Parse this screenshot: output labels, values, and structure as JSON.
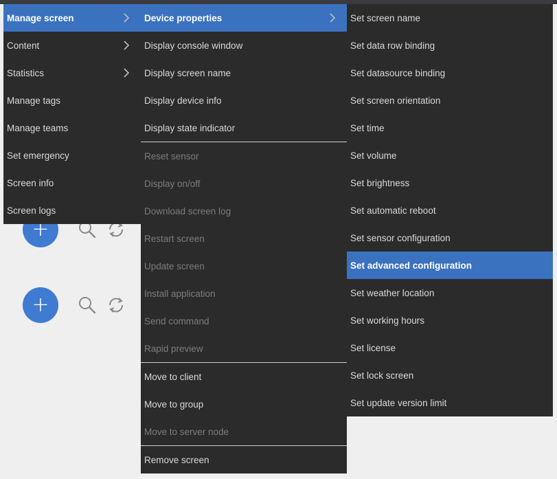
{
  "menu_level1": {
    "items": [
      {
        "label": "Manage screen",
        "active": true,
        "submenu": true,
        "disabled": false
      },
      {
        "label": "Content",
        "active": false,
        "submenu": true,
        "disabled": false
      },
      {
        "label": "Statistics",
        "active": false,
        "submenu": true,
        "disabled": false
      },
      {
        "label": "Manage tags",
        "active": false,
        "submenu": false,
        "disabled": false
      },
      {
        "label": "Manage teams",
        "active": false,
        "submenu": false,
        "disabled": false
      },
      {
        "label": "Set emergency",
        "active": false,
        "submenu": false,
        "disabled": false
      },
      {
        "label": "Screen info",
        "active": false,
        "submenu": false,
        "disabled": false
      },
      {
        "label": "Screen logs",
        "active": false,
        "submenu": false,
        "disabled": false
      }
    ]
  },
  "menu_level2": {
    "items": [
      {
        "label": "Device properties",
        "active": true,
        "submenu": true,
        "disabled": false
      },
      {
        "label": "Display console window",
        "active": false,
        "submenu": false,
        "disabled": false
      },
      {
        "label": "Display screen name",
        "active": false,
        "submenu": false,
        "disabled": false
      },
      {
        "label": "Display device info",
        "active": false,
        "submenu": false,
        "disabled": false
      },
      {
        "label": "Display state indicator",
        "active": false,
        "submenu": false,
        "disabled": false,
        "sep_after": true
      },
      {
        "label": "Reset sensor",
        "active": false,
        "submenu": false,
        "disabled": true
      },
      {
        "label": "Display on/off",
        "active": false,
        "submenu": false,
        "disabled": true
      },
      {
        "label": "Download screen log",
        "active": false,
        "submenu": false,
        "disabled": true
      },
      {
        "label": "Restart screen",
        "active": false,
        "submenu": false,
        "disabled": true
      },
      {
        "label": "Update screen",
        "active": false,
        "submenu": false,
        "disabled": true
      },
      {
        "label": "Install application",
        "active": false,
        "submenu": false,
        "disabled": true
      },
      {
        "label": "Send command",
        "active": false,
        "submenu": false,
        "disabled": true
      },
      {
        "label": "Rapid preview",
        "active": false,
        "submenu": false,
        "disabled": true,
        "sep_after": true
      },
      {
        "label": "Move to client",
        "active": false,
        "submenu": false,
        "disabled": false
      },
      {
        "label": "Move to group",
        "active": false,
        "submenu": false,
        "disabled": false
      },
      {
        "label": "Move to server node",
        "active": false,
        "submenu": false,
        "disabled": true,
        "sep_after": true
      },
      {
        "label": "Remove screen",
        "active": false,
        "submenu": false,
        "disabled": false
      }
    ]
  },
  "menu_level3": {
    "items": [
      {
        "label": "Set screen name",
        "active": false
      },
      {
        "label": "Set data row binding",
        "active": false
      },
      {
        "label": "Set datasource binding",
        "active": false
      },
      {
        "label": "Set screen orientation",
        "active": false
      },
      {
        "label": "Set time",
        "active": false
      },
      {
        "label": "Set volume",
        "active": false
      },
      {
        "label": "Set brightness",
        "active": false
      },
      {
        "label": "Set automatic reboot",
        "active": false
      },
      {
        "label": "Set sensor configuration",
        "active": false
      },
      {
        "label": "Set advanced configuration",
        "active": true
      },
      {
        "label": "Set weather location",
        "active": false
      },
      {
        "label": "Set working hours",
        "active": false
      },
      {
        "label": "Set license",
        "active": false
      },
      {
        "label": "Set lock screen",
        "active": false
      },
      {
        "label": "Set update version limit",
        "active": false
      }
    ]
  },
  "toolbar": {
    "add_symbol": "+",
    "icons": [
      "search-icon",
      "refresh-icon"
    ]
  },
  "colors": {
    "menu_bg": "#2b2b2b",
    "highlight": "#3b72c0",
    "fab": "#3f7bd0",
    "page_bg": "#efefef"
  }
}
